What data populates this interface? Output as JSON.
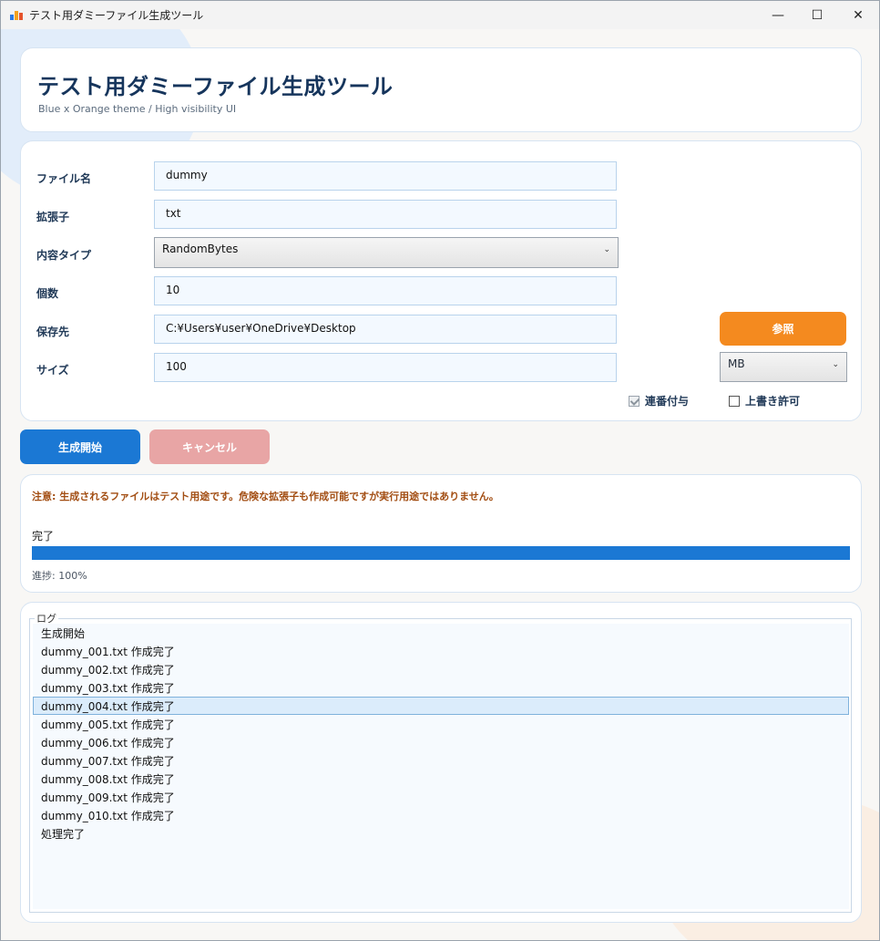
{
  "window": {
    "title": "テスト用ダミーファイル生成ツール",
    "controls": [
      "—",
      "☐",
      "✕"
    ]
  },
  "header": {
    "title": "テスト用ダミーファイル生成ツール",
    "subtitle": "Blue x Orange theme / High visibility UI"
  },
  "form": {
    "filename_label": "ファイル名",
    "filename_value": "dummy",
    "extension_label": "拡張子",
    "extension_value": "txt",
    "content_type_label": "内容タイプ",
    "content_type_value": "RandomBytes",
    "count_label": "個数",
    "count_value": "10",
    "save_to_label": "保存先",
    "save_to_value": "C:¥Users¥user¥OneDrive¥Desktop",
    "browse_label": "参照",
    "size_label": "サイズ",
    "size_value": "100",
    "size_unit": "MB",
    "serial_label": "連番付与",
    "serial_checked": true,
    "overwrite_label": "上書き許可",
    "overwrite_checked": false
  },
  "actions": {
    "start_label": "生成開始",
    "cancel_label": "キャンセル"
  },
  "status": {
    "notice": "注意: 生成されるファイルはテスト用途です。危険な拡張子も作成可能ですが実行用途ではありません。",
    "state_label": "完了",
    "progress_percent": 100,
    "progress_text": "進捗: 100%"
  },
  "log": {
    "title": "ログ",
    "selected_index": 4,
    "items": [
      "生成開始",
      "dummy_001.txt 作成完了",
      "dummy_002.txt 作成完了",
      "dummy_003.txt 作成完了",
      "dummy_004.txt 作成完了",
      "dummy_005.txt 作成完了",
      "dummy_006.txt 作成完了",
      "dummy_007.txt 作成完了",
      "dummy_008.txt 作成完了",
      "dummy_009.txt 作成完了",
      "dummy_010.txt 作成完了",
      "処理完了"
    ]
  },
  "colors": {
    "primary": "#1b78d4",
    "accent": "#f48a1f",
    "cancel": "#e8a5a5",
    "notice": "#a24d12"
  }
}
